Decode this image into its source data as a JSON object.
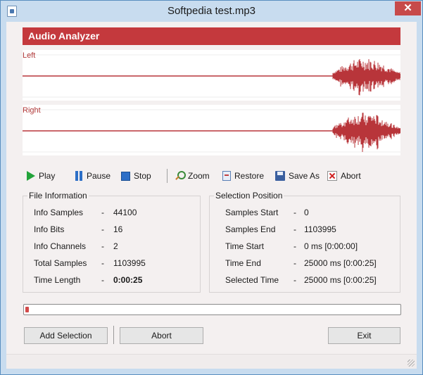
{
  "window": {
    "title": "Softpedia test.mp3",
    "close_glyph": "✕"
  },
  "panel": {
    "title": "Audio Analyzer"
  },
  "channels": {
    "left_label": "Left",
    "right_label": "Right"
  },
  "colors": {
    "accent": "#c4393d",
    "waveform": "#b8353a"
  },
  "toolbar": {
    "play": "Play",
    "pause": "Pause",
    "stop": "Stop",
    "zoom": "Zoom",
    "restore": "Restore",
    "save_as": "Save As",
    "abort": "Abort"
  },
  "file_info": {
    "title": "File Information",
    "rows": [
      {
        "label": "Info Samples",
        "value": "44100"
      },
      {
        "label": "Info Bits",
        "value": "16"
      },
      {
        "label": "Info Channels",
        "value": "2"
      },
      {
        "label": "Total Samples",
        "value": "1103995"
      },
      {
        "label": "Time Length",
        "value": "0:00:25"
      }
    ]
  },
  "selection": {
    "title": "Selection Position",
    "rows": [
      {
        "label": "Samples Start",
        "value": "0"
      },
      {
        "label": "Samples End",
        "value": "1103995"
      },
      {
        "label": "Time Start",
        "value": "0 ms [0:00:00]"
      },
      {
        "label": "Time End",
        "value": "25000 ms [0:00:25]"
      },
      {
        "label": "Selected Time",
        "value": "25000 ms [0:00:25]"
      }
    ]
  },
  "separator": "-",
  "progress": {
    "fraction": 0.01
  },
  "buttons": {
    "add_selection": "Add Selection",
    "abort": "Abort",
    "exit": "Exit"
  }
}
